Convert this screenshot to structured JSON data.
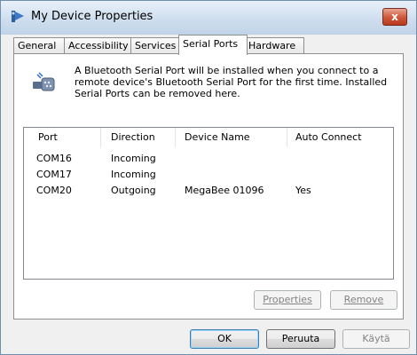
{
  "window": {
    "title": "My Device Properties",
    "close_label": "x"
  },
  "tabs": [
    {
      "label": "General",
      "active": false
    },
    {
      "label": "Accessibility",
      "active": false
    },
    {
      "label": "Services",
      "active": false
    },
    {
      "label": "Serial Ports",
      "active": true
    },
    {
      "label": "Hardware",
      "active": false
    }
  ],
  "panel": {
    "description": "A Bluetooth Serial Port will be installed when you connect to a remote device's Bluetooth Serial Port for the first time. Installed Serial Ports can be removed here.",
    "columns": [
      "Port",
      "Direction",
      "Device Name",
      "Auto Connect"
    ],
    "rows": [
      {
        "port": "COM16",
        "direction": "Incoming",
        "device": "",
        "auto": ""
      },
      {
        "port": "COM17",
        "direction": "Incoming",
        "device": "",
        "auto": ""
      },
      {
        "port": "COM20",
        "direction": "Outgoing",
        "device": "MegaBee 01096",
        "auto": "Yes"
      }
    ],
    "properties_label": "Properties",
    "remove_label": "Remove"
  },
  "footer": {
    "ok_label": "OK",
    "cancel_label": "Peruuta",
    "apply_label": "Käytä"
  },
  "icons": {
    "title": "bluetooth-device-icon",
    "panel": "serial-port-icon"
  }
}
